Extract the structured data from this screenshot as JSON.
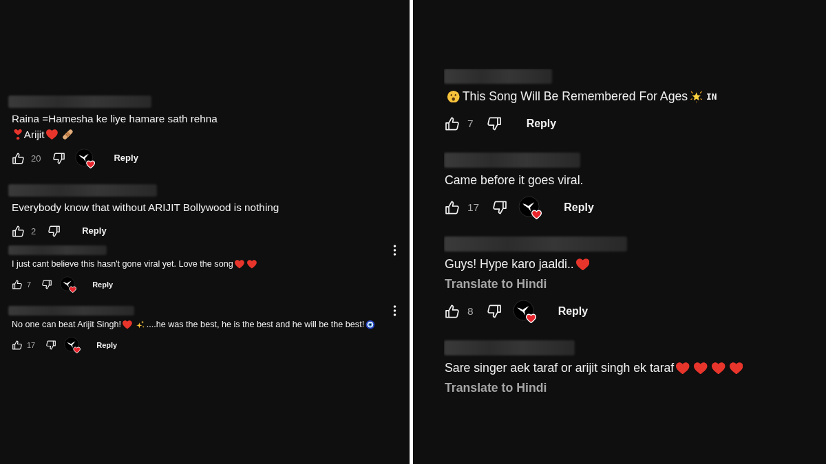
{
  "panels": [
    {
      "groups": [
        {
          "comments": [
            {
              "lines": [
                [
                  {
                    "kind": "text",
                    "text": "Raina =Hamesha ke liye hamare sath rehna"
                  }
                ],
                [
                  {
                    "kind": "heart_exclamation"
                  },
                  {
                    "kind": "text",
                    "text": "Arijit"
                  },
                  {
                    "kind": "heart"
                  },
                  {
                    "kind": "bandage"
                  }
                ]
              ],
              "menu_button": false,
              "likes": "20",
              "creator_heart": true,
              "reply": "Reply"
            },
            {
              "lines": [
                [
                  {
                    "kind": "text",
                    "text": "Everybody know that without ARIJIT Bollywood is nothing"
                  }
                ]
              ],
              "menu_button": false,
              "likes": "2",
              "creator_heart": false,
              "reply": "Reply"
            }
          ]
        },
        {
          "comments": [
            {
              "lines": [
                [
                  {
                    "kind": "text",
                    "text": "I just cant believe this hasn't gone viral yet. Love the song"
                  },
                  {
                    "kind": "heart"
                  },
                  {
                    "kind": "heart"
                  }
                ]
              ],
              "menu_button": true,
              "likes": "7",
              "creator_heart": true,
              "reply": "Reply"
            },
            {
              "lines": [
                [
                  {
                    "kind": "text",
                    "text": "No one can beat Arijit Singh!"
                  },
                  {
                    "kind": "heart"
                  },
                  {
                    "kind": "sparkles"
                  },
                  {
                    "kind": "text",
                    "text": "....he was the best, he is the best and he will be the best!"
                  },
                  {
                    "kind": "nazar_amulet"
                  }
                ]
              ],
              "menu_button": true,
              "likes": "17",
              "creator_heart": true,
              "reply": "Reply"
            }
          ]
        }
      ]
    },
    {
      "groups": [
        {
          "comments": [
            {
              "lines": [
                [
                  {
                    "kind": "astonished_face"
                  },
                  {
                    "kind": "text",
                    "text": "This Song Will Be Remembered For Ages"
                  },
                  {
                    "kind": "glowing_star"
                  },
                  {
                    "kind": "flag_code",
                    "text": "IN"
                  }
                ]
              ],
              "menu_button": false,
              "likes": "7",
              "creator_heart": false,
              "reply": "Reply"
            },
            {
              "lines": [
                [
                  {
                    "kind": "text",
                    "text": "Came before it goes viral."
                  }
                ]
              ],
              "menu_button": false,
              "likes": "17",
              "creator_heart": true,
              "reply": "Reply"
            },
            {
              "lines": [
                [
                  {
                    "kind": "text",
                    "text": "Guys! Hype karo jaaldi.."
                  },
                  {
                    "kind": "heart"
                  }
                ]
              ],
              "translate": "Translate to Hindi",
              "menu_button": false,
              "likes": "8",
              "creator_heart": true,
              "reply": "Reply"
            },
            {
              "lines": [
                [
                  {
                    "kind": "text",
                    "text": "Sare singer aek taraf or arijit singh ek taraf"
                  },
                  {
                    "kind": "heart"
                  },
                  {
                    "kind": "heart"
                  },
                  {
                    "kind": "heart"
                  },
                  {
                    "kind": "heart"
                  }
                ]
              ],
              "translate": "Translate to Hindi",
              "menu_button": false
            }
          ]
        }
      ]
    }
  ]
}
